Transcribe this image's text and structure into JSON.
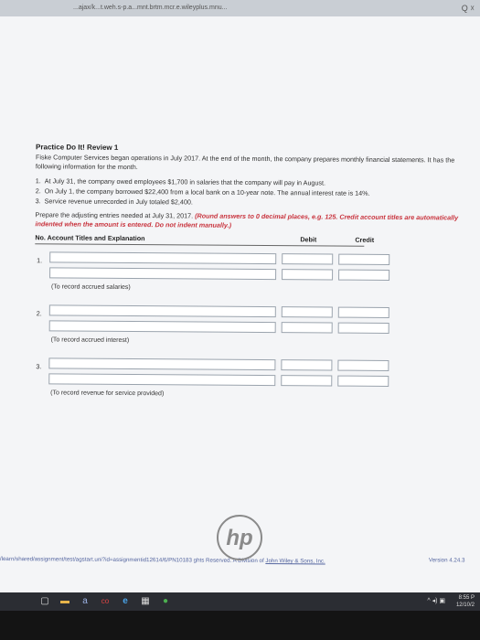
{
  "browser": {
    "url_fragment": "...ajax/k...t.weh.s-p.a...mnt.brtm.mcr.e.wileyplus.mnu...",
    "top_icons": "Q  ☓"
  },
  "problem": {
    "title": "Practice Do It! Review 1",
    "intro": "Fiske Computer Services began operations in July 2017. At the end of the month, the company prepares monthly financial statements. It has the following information for the month.",
    "items": [
      {
        "num": "1.",
        "text": "At July 31, the company owed employees $1,700 in salaries that the company will pay in August."
      },
      {
        "num": "2.",
        "text": "On July 1, the company borrowed $22,400 from a local bank on a 10-year note. The annual interest rate is 14%."
      },
      {
        "num": "3.",
        "text": "Service revenue unrecorded in July totaled $2,400."
      }
    ],
    "instruction_plain": "Prepare the adjusting entries needed at July 31, 2017.",
    "instruction_red": "(Round answers to 0 decimal places, e.g. 125. Credit account titles are automatically indented when the amount is entered. Do not indent manually.)"
  },
  "table": {
    "headers": {
      "account": "No. Account Titles and Explanation",
      "debit": "Debit",
      "credit": "Credit"
    },
    "entries": [
      {
        "num": "1.",
        "note": "(To record accrued salaries)"
      },
      {
        "num": "2.",
        "note": "(To record accrued interest)"
      },
      {
        "num": "3.",
        "note": "(To record revenue for service provided)"
      }
    ]
  },
  "footer": {
    "path": "/learn/shared/assignment/test/agstart.uni?id=assignmentid12614/6/PN10183",
    "rights": "ghts Reserved. A Division of ",
    "company": "John Wiley & Sons, Inc.",
    "version": "Version 4.24.3"
  },
  "taskbar": {
    "icons": [
      "▢",
      "▬",
      "a",
      "co",
      "e",
      "▦",
      "●"
    ],
    "sys": "^ ◂) ▣",
    "time": "8:55 P",
    "date": "12/10/2"
  },
  "brand": "hp",
  "colors": {
    "accent_red": "#c8323c",
    "page_bg": "#f4f5f7",
    "taskbar_bg": "#2b2d33"
  }
}
